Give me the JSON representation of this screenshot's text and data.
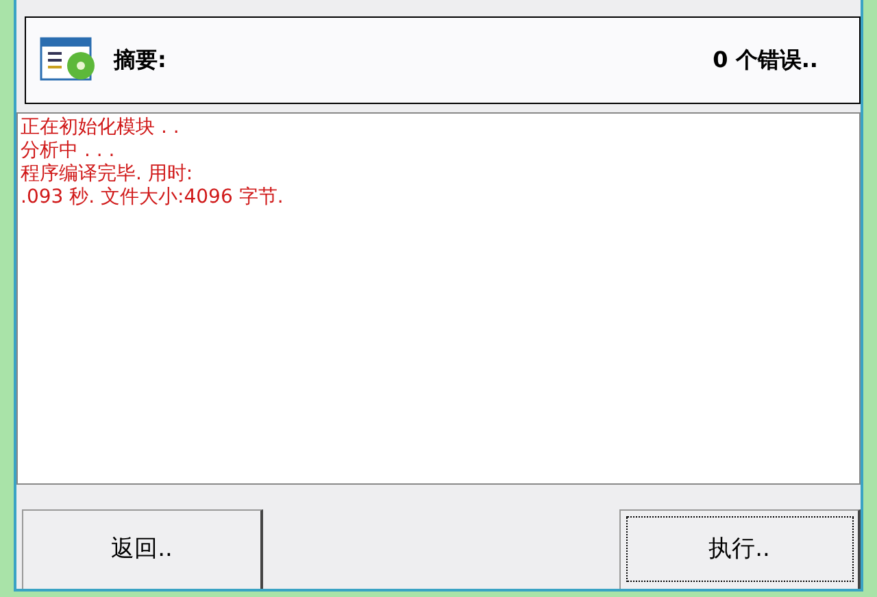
{
  "header": {
    "title": "摘要:",
    "status": "0 个错误.."
  },
  "log": [
    "正在初始化模块 . .",
    "分析中 . . .",
    "程序编译完毕. 用时:",
    ".093 秒. 文件大小:4096 字节."
  ],
  "buttons": [
    {
      "label": "返回..",
      "focused": false
    },
    {
      "label": "执行..",
      "focused": true
    }
  ]
}
